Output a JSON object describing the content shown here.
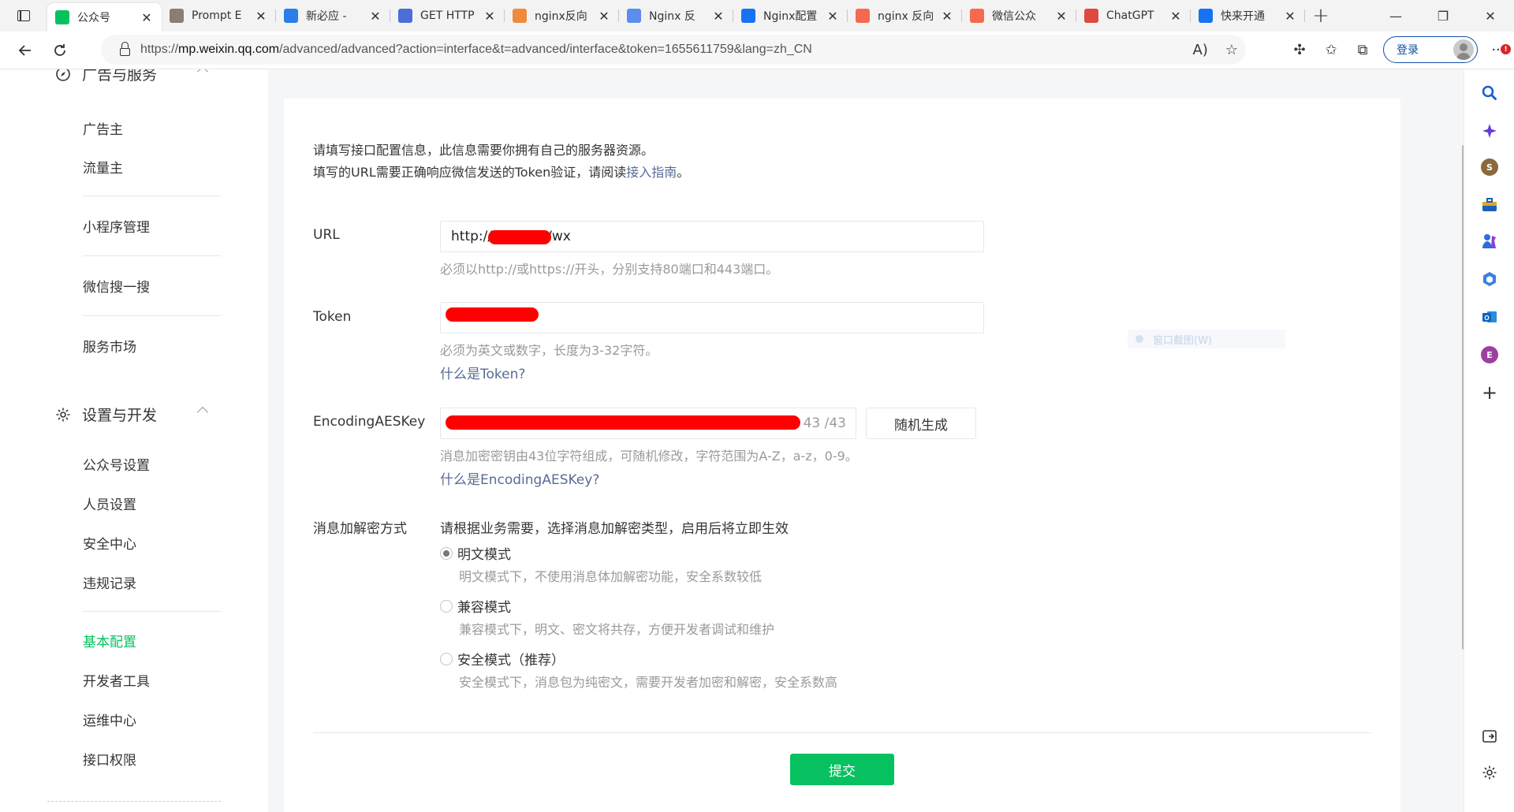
{
  "browser": {
    "tabs": [
      {
        "label": "公众号",
        "icon": "wechat-official-icon",
        "color": "#07c160",
        "active": true
      },
      {
        "label": "Prompt E",
        "icon": "image-thumb-icon",
        "color": "#8a7d74"
      },
      {
        "label": "新必应 -",
        "icon": "bing-icon",
        "color": "#2b7de9"
      },
      {
        "label": "GET HTTP",
        "icon": "search-icon",
        "color": "#4a6fd6"
      },
      {
        "label": "nginx反向",
        "icon": "code-bracket-icon",
        "color": "#f08a3c"
      },
      {
        "label": "Nginx 反",
        "icon": "layers-icon",
        "color": "#5b8def"
      },
      {
        "label": "Nginx配置",
        "icon": "zhihu-icon",
        "color": "#1772f6"
      },
      {
        "label": "nginx 反向",
        "icon": "csdn-icon",
        "color": "#f56a4f"
      },
      {
        "label": "微信公众",
        "icon": "csdn-icon",
        "color": "#f56a4f"
      },
      {
        "label": "ChatGPT",
        "icon": "bolt-icon",
        "color": "#e0493d"
      },
      {
        "label": "快来开通",
        "icon": "zhihu-icon",
        "color": "#1772f6"
      }
    ],
    "tab_close_glyph": "✕",
    "new_tab_glyph": "+",
    "url_scheme": "https://",
    "url_host": "mp.weixin.qq.com",
    "url_path": "/advanced/advanced?action=interface&t=advanced/interface&token=1655611759&lang=zh_CN",
    "login_label": "登录",
    "more_badge": "!"
  },
  "sidebar": {
    "group_ads": "广告与服务",
    "ads_items": [
      "广告主",
      "流量主"
    ],
    "mini_program": "小程序管理",
    "wechat_search": "微信搜一搜",
    "service_market": "服务市场",
    "group_dev": "设置与开发",
    "dev_items": [
      "公众号设置",
      "人员设置",
      "安全中心",
      "违规记录"
    ],
    "dev_tools": [
      "基本配置",
      "开发者工具",
      "运维中心",
      "接口权限"
    ]
  },
  "form": {
    "intro_line1": "请填写接口配置信息，此信息需要你拥有自己的服务器资源。",
    "intro_line2_pre": "填写的URL需要正确响应微信发送的Token验证，请阅读",
    "intro_line2_link": "接入指南",
    "intro_line2_post": "。",
    "url_label": "URL",
    "url_value_prefix": "http://",
    "url_value_suffix": "/wx",
    "url_hint": "必须以http://或https://开头，分别支持80端口和443端口。",
    "token_label": "Token",
    "token_hint": "必须为英文或数字，长度为3-32字符。",
    "token_link": "什么是Token?",
    "aes_label": "EncodingAESKey",
    "aes_counter": "43 /43",
    "aes_generate": "随机生成",
    "aes_hint": "消息加密密钥由43位字符组成，可随机修改，字符范围为A-Z，a-z，0-9。",
    "aes_link": "什么是EncodingAESKey?",
    "mode_label": "消息加解密方式",
    "mode_intro": "请根据业务需要，选择消息加解密类型，启用后将立即生效",
    "modes": [
      {
        "label": "明文模式",
        "desc": "明文模式下，不使用消息体加解密功能，安全系数较低",
        "selected": true
      },
      {
        "label": "兼容模式",
        "desc": "兼容模式下，明文、密文将共存，方便开发者调试和维护",
        "selected": false
      },
      {
        "label": "安全模式（推荐）",
        "desc": "安全模式下，消息包为纯密文，需要开发者加密和解密，安全系数高",
        "selected": false
      }
    ],
    "submit": "提交"
  },
  "ghost_tip": "窗口截图(W)",
  "colors": {
    "accent": "#07c160",
    "link": "#576b95",
    "redaction": "#ff0000"
  }
}
